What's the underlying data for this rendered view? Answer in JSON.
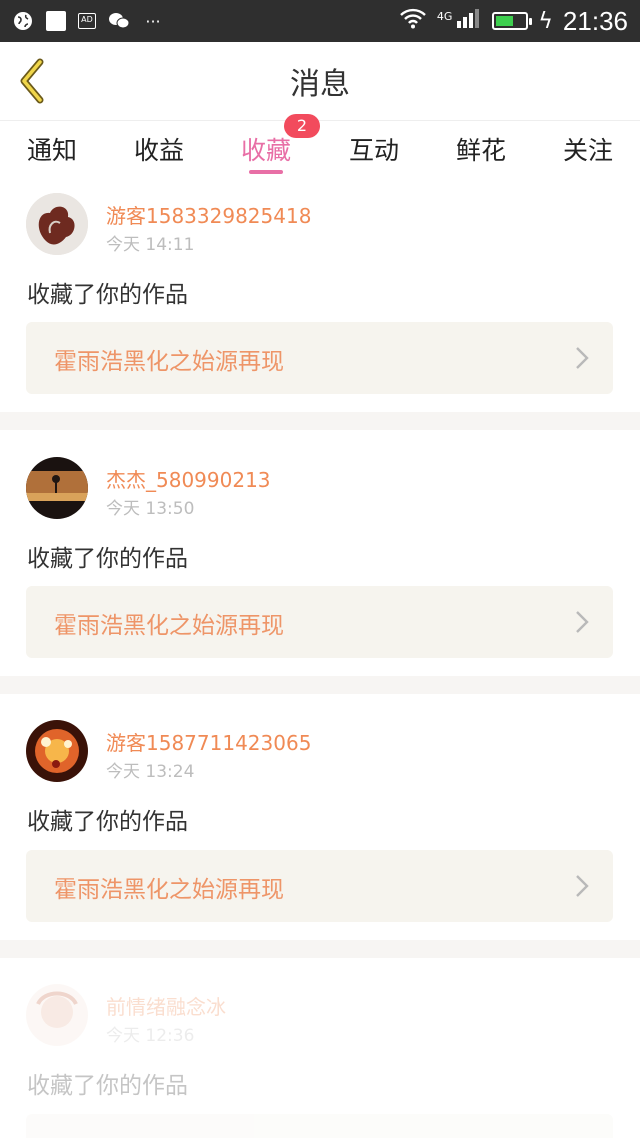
{
  "status_bar": {
    "time": "21:36",
    "network": "4G",
    "signal_sub": "1",
    "ad_label": "AD",
    "icons": [
      "globe-icon",
      "white-square-icon",
      "ad-icon",
      "wechat-icon",
      "more-dots-icon",
      "wifi-icon",
      "signal-icon",
      "battery-icon",
      "charging-icon"
    ]
  },
  "header": {
    "title": "消息",
    "back_icon": "back-chevron-icon"
  },
  "tabs": [
    {
      "label": "通知",
      "active": false
    },
    {
      "label": "收益",
      "active": false
    },
    {
      "label": "收藏",
      "active": true,
      "badge": "2"
    },
    {
      "label": "互动",
      "active": false
    },
    {
      "label": "鲜花",
      "active": false
    },
    {
      "label": "关注",
      "active": false
    }
  ],
  "messages": [
    {
      "username": "游客1583329825418",
      "time": "今天 14:11",
      "action": "收藏了你的作品",
      "work_title": "霍雨浩黑化之始源再现"
    },
    {
      "username": "杰杰_580990213",
      "time": "今天 13:50",
      "action": "收藏了你的作品",
      "work_title": "霍雨浩黑化之始源再现"
    },
    {
      "username": "游客1587711423065",
      "time": "今天 13:24",
      "action": "收藏了你的作品",
      "work_title": "霍雨浩黑化之始源再现"
    },
    {
      "username": "前情绪融念冰",
      "time": "今天 12:36",
      "action": "收藏了你的作品",
      "work_title": ""
    }
  ],
  "colors": {
    "accent": "#e86fa6",
    "username": "#f08a55",
    "work_title": "#ee9568",
    "badge": "#f24b5d"
  }
}
